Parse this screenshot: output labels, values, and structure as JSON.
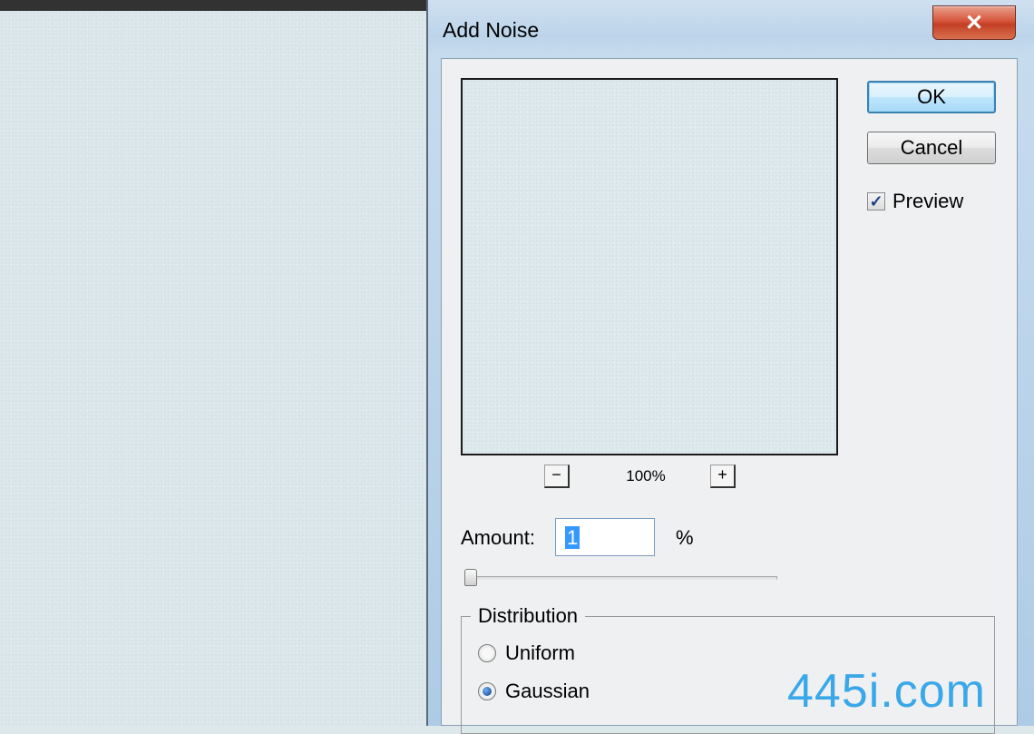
{
  "dialog": {
    "title": "Add Noise",
    "close_symbol": "✕"
  },
  "preview": {
    "zoom_out_label": "−",
    "zoom_in_label": "+",
    "zoom_level": "100%"
  },
  "buttons": {
    "ok": "OK",
    "cancel": "Cancel"
  },
  "preview_checkbox": {
    "label": "Preview",
    "checked": true,
    "check_glyph": "✓"
  },
  "amount": {
    "label": "Amount:",
    "value": "1",
    "unit": "%",
    "slider_fraction": 0.01
  },
  "distribution": {
    "legend": "Distribution",
    "options": [
      {
        "label": "Uniform",
        "selected": false
      },
      {
        "label": "Gaussian",
        "selected": true
      }
    ]
  },
  "watermark": "445i.com",
  "icons": {
    "close": "close-icon",
    "checkbox": "checkmark-icon",
    "radio": "radio-dot-icon"
  }
}
